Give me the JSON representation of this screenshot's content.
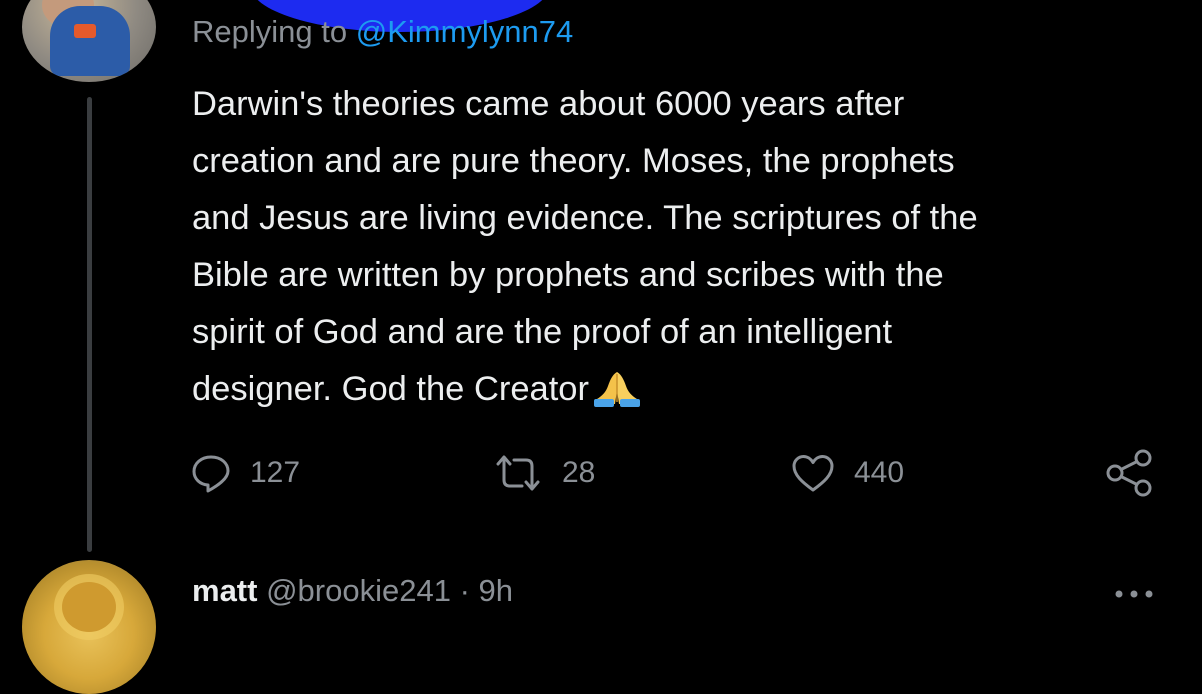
{
  "reply_context": {
    "prefix": "Replying to",
    "handle": "@Kimmylynn74"
  },
  "tweet": {
    "text": "Darwin's theories came about 6000 years after\ncreation and are pure theory.  Moses, the prophets\nand Jesus are living evidence.  The scriptures of the\nBible are written by prophets and scribes with the\nspirit of God and are the proof of an intelligent\ndesigner.  God the Creator",
    "emoji": "folded-hands-emoji"
  },
  "actions": {
    "reply_count": "127",
    "retweet_count": "28",
    "like_count": "440",
    "icons": [
      "reply-icon",
      "retweet-icon",
      "like-icon",
      "share-icon"
    ]
  },
  "next_tweet": {
    "name": "matt",
    "handle": "@brookie241",
    "separator": "·",
    "time": "9h",
    "more_icon": "more-icon"
  },
  "colors": {
    "background": "#000000",
    "text": "#eceeef",
    "secondary": "#8b9096",
    "accent": "#1d9bf0",
    "redaction": "#1d2bf0"
  }
}
